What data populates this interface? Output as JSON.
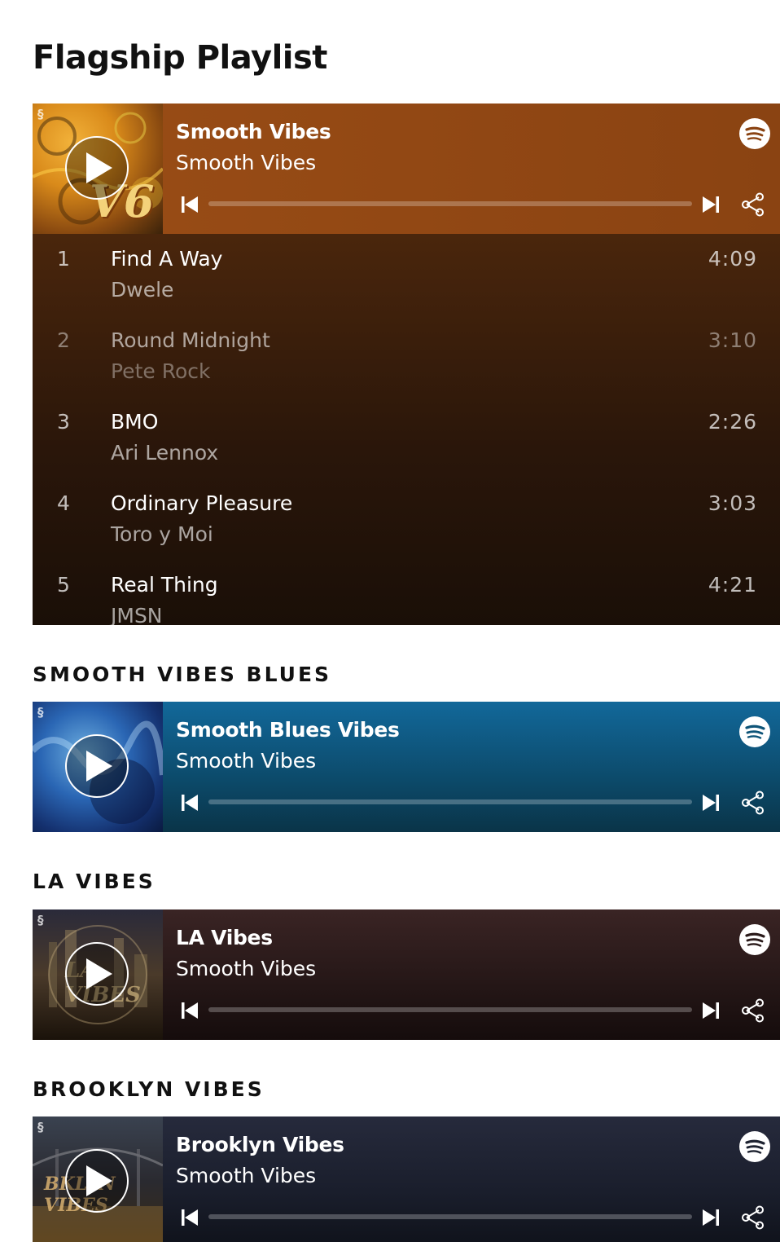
{
  "page": {
    "title": "Flagship Playlist"
  },
  "colors": {
    "flagship_bg": "#8c4514",
    "blues_bg": "#0e5478",
    "la_bg": "#2a1a1a",
    "brooklyn_bg": "#1d2230"
  },
  "flagship": {
    "title": "Smooth Vibes",
    "subtitle": "Smooth Vibes",
    "art_text": "V6",
    "tracks": [
      {
        "num": "1",
        "name": "Find A Way",
        "artist": "Dwele",
        "duration": "4:09"
      },
      {
        "num": "2",
        "name": "Round Midnight",
        "artist": "Pete Rock",
        "duration": "3:10"
      },
      {
        "num": "3",
        "name": "BMO",
        "artist": "Ari Lennox",
        "duration": "2:26"
      },
      {
        "num": "4",
        "name": "Ordinary Pleasure",
        "artist": "Toro y Moi",
        "duration": "3:03"
      },
      {
        "num": "5",
        "name": "Real Thing",
        "artist": "JMSN",
        "duration": "4:21"
      }
    ]
  },
  "sections": [
    {
      "heading": "SMOOTH VIBES BLUES",
      "title": "Smooth Blues Vibes",
      "subtitle": "Smooth Vibes",
      "art_text": ""
    },
    {
      "heading": "LA VIBES",
      "title": "LA Vibes",
      "subtitle": "Smooth Vibes",
      "art_text": "LA VIBES"
    },
    {
      "heading": "BROOKLYN VIBES",
      "title": "Brooklyn Vibes",
      "subtitle": "Smooth Vibes",
      "art_text": "BKLYN VIBES"
    }
  ],
  "icons": {
    "play": "play-icon",
    "spotify": "spotify-icon",
    "previous": "skip-previous-icon",
    "next": "skip-next-icon",
    "share": "share-icon",
    "logo": "smooth-vibes-logo-icon"
  },
  "progress": {
    "flagship": 0,
    "blues": 0,
    "la": 0,
    "brooklyn": 0
  }
}
